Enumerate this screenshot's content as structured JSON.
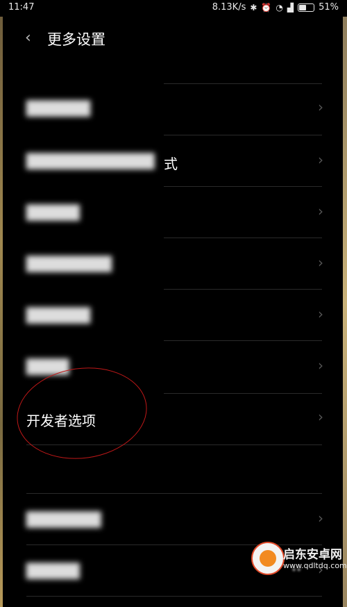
{
  "status_bar": {
    "time": "11:47",
    "net_speed": "8.13K/s",
    "battery": "51%",
    "battery_level": 0.51
  },
  "header": {
    "back_icon": "chevron-left-icon",
    "title": "更多设置"
  },
  "list": {
    "items": [
      {
        "label": "██████",
        "blurred": true
      },
      {
        "label": "████████████",
        "blurred": true
      },
      {
        "label": "█████",
        "blurred": true
      },
      {
        "label": "████████",
        "blurred": true
      },
      {
        "label": "██████",
        "blurred": true
      },
      {
        "label": "████",
        "blurred": true
      },
      {
        "label": "开发者选项",
        "blurred": false
      },
      {
        "label": "",
        "blurred": false
      },
      {
        "label": "███████",
        "blurred": true
      },
      {
        "label": "█████",
        "blurred": true
      }
    ],
    "partial_suffix": "式",
    "last_row_badge": "••"
  },
  "watermark": {
    "name": "启东安卓网",
    "url": "www.qdltdq.com"
  }
}
